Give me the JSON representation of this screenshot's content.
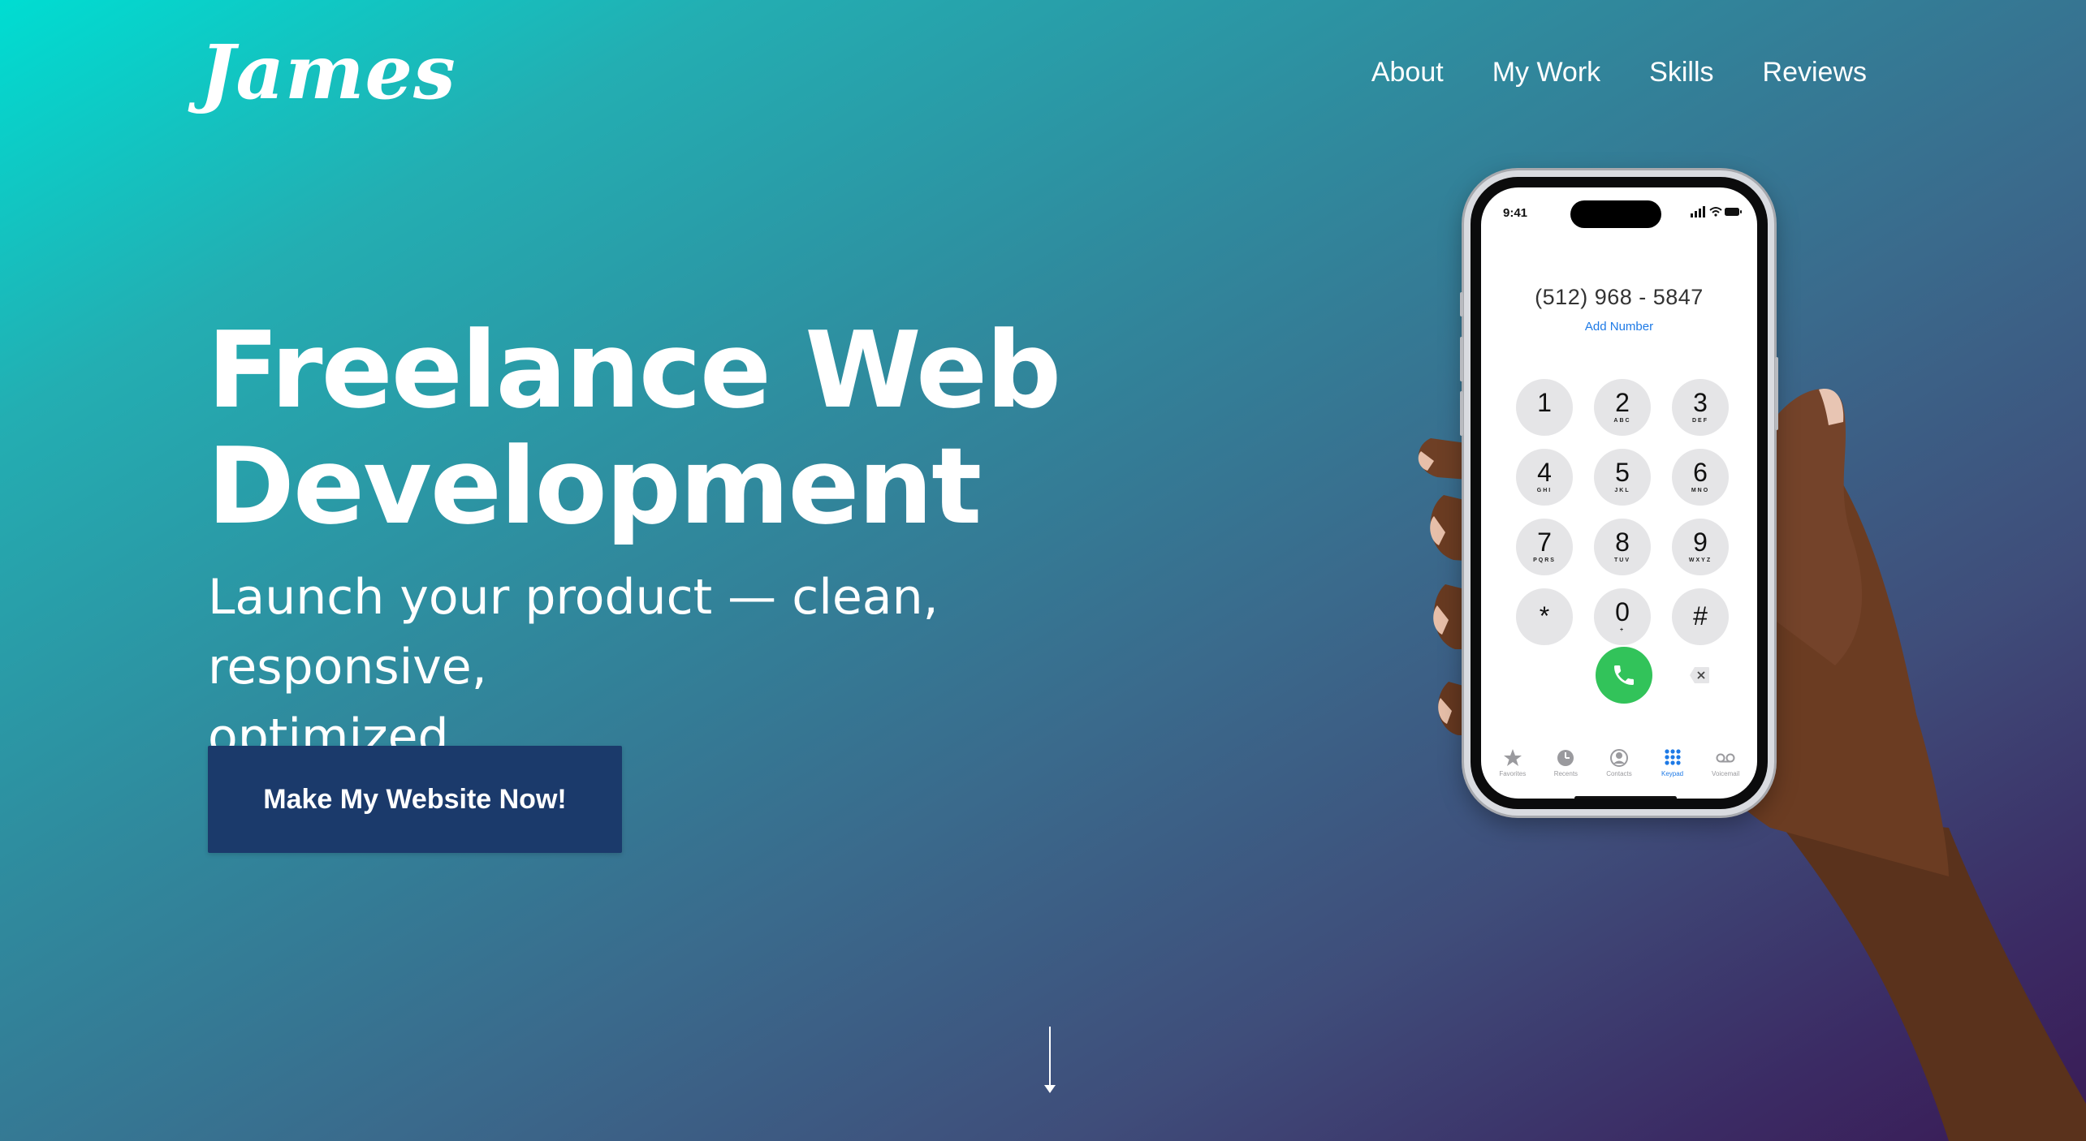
{
  "brand": {
    "logo_text": "James"
  },
  "nav": {
    "items": [
      {
        "label": "About"
      },
      {
        "label": "My Work"
      },
      {
        "label": "Skills"
      },
      {
        "label": "Reviews"
      }
    ]
  },
  "hero": {
    "title_line1": "Freelance Web",
    "title_line2": "Development",
    "subtitle_line1": "Launch your product — clean, responsive,",
    "subtitle_line2": "optimized.",
    "cta_label": "Make My Website Now!"
  },
  "phone": {
    "status_time": "9:41",
    "dialed_number": "(512) 968 - 5847",
    "add_number_label": "Add Number",
    "keys": [
      {
        "num": "1",
        "letters": ""
      },
      {
        "num": "2",
        "letters": "ABC"
      },
      {
        "num": "3",
        "letters": "DEF"
      },
      {
        "num": "4",
        "letters": "GHI"
      },
      {
        "num": "5",
        "letters": "JKL"
      },
      {
        "num": "6",
        "letters": "MNO"
      },
      {
        "num": "7",
        "letters": "PQRS"
      },
      {
        "num": "8",
        "letters": "TUV"
      },
      {
        "num": "9",
        "letters": "WXYZ"
      },
      {
        "num": "*",
        "letters": ""
      },
      {
        "num": "0",
        "letters": "+"
      },
      {
        "num": "#",
        "letters": ""
      }
    ],
    "tabs": [
      {
        "label": "Favorites",
        "icon": "star-icon"
      },
      {
        "label": "Recents",
        "icon": "clock-icon"
      },
      {
        "label": "Contacts",
        "icon": "contact-icon"
      },
      {
        "label": "Keypad",
        "icon": "keypad-icon",
        "active": true
      },
      {
        "label": "Voicemail",
        "icon": "voicemail-icon"
      }
    ]
  },
  "colors": {
    "gradient_start": "#00ddd2",
    "gradient_end": "#3a1a55",
    "cta_background": "#1b3a6b",
    "call_green": "#32c35a",
    "ios_blue": "#1e7ae6"
  },
  "icons": {
    "scroll_down": "down-arrow-icon",
    "call": "phone-icon",
    "delete": "delete-icon"
  }
}
